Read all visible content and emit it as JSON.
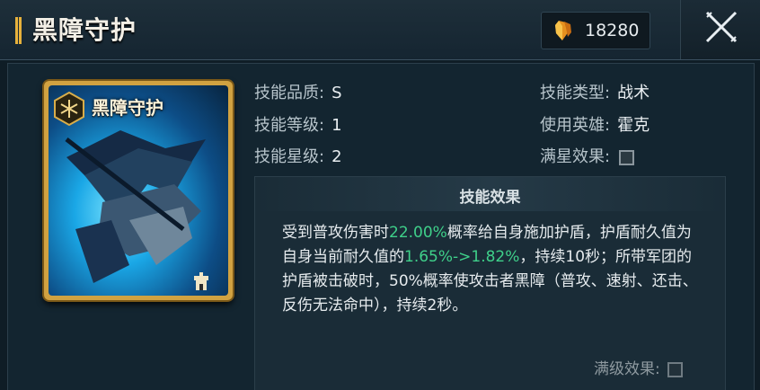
{
  "header": {
    "title": "黑障守护",
    "currency_icon": "crystal-icon",
    "currency_value": "18280",
    "close_icon": "close-icon"
  },
  "card": {
    "name": "黑障守护",
    "emblem_icon": "skill-emblem-icon",
    "badge_icon": "tower-icon"
  },
  "attributes": {
    "quality_label": "技能品质:",
    "quality_value": "S",
    "level_label": "技能等级:",
    "level_value": "1",
    "star_label": "技能星级:",
    "star_value": "2",
    "type_label": "技能类型:",
    "type_value": "战术",
    "hero_label": "使用英雄:",
    "hero_value": "霍克",
    "full_star_label": "满星效果:"
  },
  "effect": {
    "title": "技能效果",
    "t1": "受到普攻伤害时",
    "t2": "22.00%",
    "t3": "概率给自身施加护盾，护盾耐久值为自身当前耐久值的",
    "t4": "1.65%->1.82%",
    "t5": "，持续10秒；所带军团的护盾被击破时，50%概率使攻击者黑障（普攻、速射、还击、反伤无法命中），持续2秒。",
    "max_level_label": "满级效果:"
  },
  "colors": {
    "highlight": "#3fd08a",
    "title_accent": "#e7b13c",
    "card_frame": "#d1a241"
  }
}
